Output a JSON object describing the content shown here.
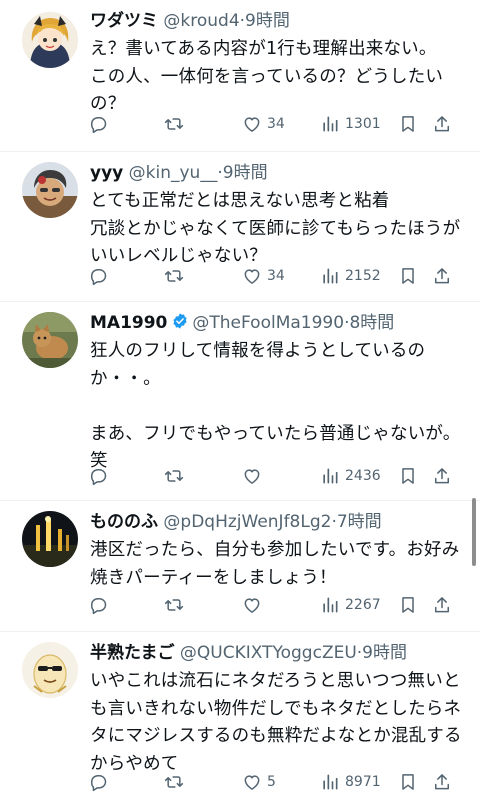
{
  "tweets": [
    {
      "name": "ワダツミ",
      "handle": "@kroud4",
      "time": "·9時間",
      "verified": false,
      "text": "え？書いてある内容が1行も理解出来ない。\nこの人、一体何を言っているの？どうしたい\nの？",
      "replies": "",
      "retweets": "",
      "likes": "34",
      "views": "1301"
    },
    {
      "name": "yyy",
      "handle": "@kin_yu__",
      "time": "·9時間",
      "verified": false,
      "text": "とても正常だとは思えない思考と粘着\n冗談とかじゃなくて医師に診てもらったほうが\nいいレベルじゃない？",
      "replies": "",
      "retweets": "",
      "likes": "34",
      "views": "2152"
    },
    {
      "name": "MA1990",
      "handle": "@TheFoolMa1990",
      "time": "·8時間",
      "verified": true,
      "text": "狂人のフリして情報を得ようとしているの\nか・・。\n\nまあ、フリでもやっていたら普通じゃないが。\n笑",
      "replies": "",
      "retweets": "",
      "likes": "",
      "views": "2436"
    },
    {
      "name": "もののふ",
      "handle": "@pDqHzjWenJf8Lg2",
      "time": "·7時間",
      "verified": false,
      "text": "港区だったら、自分も参加したいです。お好み\n焼きパーティーをしましょう！",
      "replies": "",
      "retweets": "",
      "likes": "",
      "views": "2267"
    },
    {
      "name": "半熟たまご",
      "handle": "@QUCKIXTYoggcZEU",
      "time": "·9時間",
      "verified": false,
      "text": "いやこれは流石にネタだろうと思いつつ無いと\nも言いきれない物件だしでもネタだとしたらネ\nタにマジレスするのも無粋だよなとか混乱する\nからやめて",
      "replies": "",
      "retweets": "",
      "likes": "5",
      "views": "8971"
    }
  ],
  "colors": {
    "text": "#0f1419",
    "secondary": "#536471",
    "divider": "#eff3f4",
    "verified": "#1d9bf0"
  },
  "icons": [
    "reply-icon",
    "retweet-icon",
    "like-icon",
    "views-icon",
    "bookmark-icon",
    "share-icon",
    "verified-badge-icon"
  ]
}
